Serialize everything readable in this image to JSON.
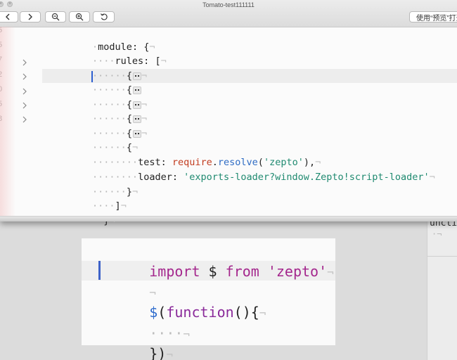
{
  "window": {
    "title": "Tomato-test111111",
    "close_glyph": "×",
    "zoom_glyph": "×",
    "toolbar": {
      "back_icon": "chevron-left-icon",
      "forward_icon": "chevron-right-icon",
      "zoom_out_icon": "zoom-out-icon",
      "zoom_in_icon": "zoom-in-icon",
      "rotate_icon": "rotate-left-icon",
      "open_with_label": "使用“预览”打开"
    }
  },
  "top_editor": {
    "gutter_numbers": [
      "5",
      "5",
      "7",
      "2",
      "0",
      "5",
      "8"
    ],
    "lines": {
      "l1": {
        "ws": "·",
        "code": "module: {",
        "pil": "¬"
      },
      "l2": {
        "ws": "····",
        "code": "rules: [",
        "pil": "¬"
      },
      "l3": {
        "ws": "······",
        "code": "{",
        "pil": "¬"
      },
      "l4": {
        "ws": "······",
        "code": "{"
      },
      "l5": {
        "ws": "······",
        "code": "{",
        "pil": "¬"
      },
      "l6": {
        "ws": "······",
        "code": "{",
        "pil": "¬"
      },
      "l7": {
        "ws": "······",
        "code": "{",
        "pil": "¬"
      },
      "l8": {
        "ws": "······",
        "code": "{",
        "pil": "¬"
      },
      "l9": {
        "ws": "········",
        "prop": "test: ",
        "call": "require",
        "dot": ".",
        "method": "resolve",
        "open": "(",
        "str": "'zepto'",
        "close": "),",
        "pil": "¬"
      },
      "l10": {
        "ws": "········",
        "prop": "loader: ",
        "str": "'exports-loader?window.Zepto!script-loader'",
        "pil": "¬"
      },
      "l11": {
        "ws": "······",
        "code": "}",
        "pil": "¬"
      },
      "l12": {
        "ws": "····",
        "code": "]",
        "pil": "¬"
      },
      "l13": {
        "ws": "··",
        "code": "}",
        "pil": "¬"
      }
    }
  },
  "background_editor": {
    "partial_text": "unctio",
    "partial_ws": "·¬"
  },
  "bottom_editor": {
    "line1": {
      "kw": "import",
      "mid": " $ ",
      "kw2": "from",
      "sp": " ",
      "str": "'zepto'",
      "pil": "¬"
    },
    "line2": {
      "pil": "¬"
    },
    "line3": {
      "dollar": "$",
      "open": "(",
      "fn": "function",
      "rest": "(){",
      "pil": "¬"
    },
    "line4": {
      "ws": "····",
      "pil": "¬"
    },
    "line5": {
      "code": "})",
      "pil": "¬"
    }
  },
  "colors": {
    "keyword_purple": "#a4278d",
    "string_green": "#1f8a70",
    "method_blue": "#2d6bc4",
    "call_red": "#c23d20",
    "caret_blue": "#2c5fd0"
  }
}
